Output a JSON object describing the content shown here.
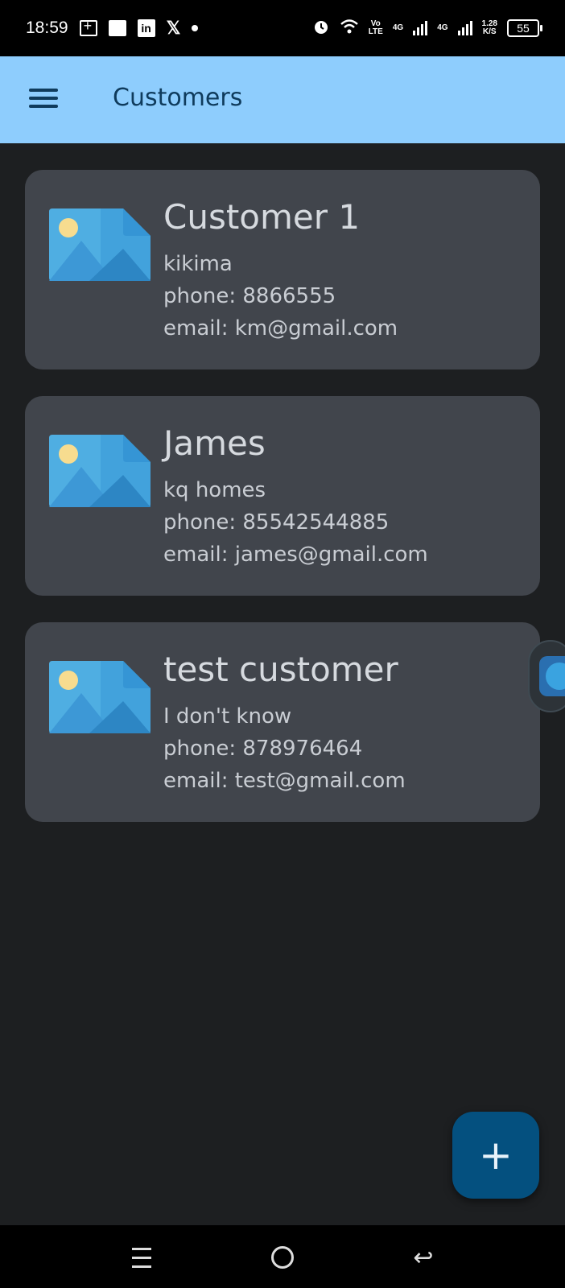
{
  "status_bar": {
    "time": "18:59",
    "network_label_top": "Vo",
    "network_label_bottom": "LTE",
    "signal1_label": "4G",
    "signal2_label": "4G",
    "speed_value": "1.28",
    "speed_unit": "K/S",
    "battery": "55"
  },
  "app_bar": {
    "title": "Customers"
  },
  "customers": [
    {
      "name": "Customer 1",
      "company": "kikima",
      "phone": "phone: 8866555",
      "email": "email: km@gmail.com"
    },
    {
      "name": "James",
      "company": "kq homes",
      "phone": "phone: 85542544885",
      "email": "email: james@gmail.com"
    },
    {
      "name": "test customer",
      "company": "I don't know",
      "phone": "phone: 878976464",
      "email": "email: test@gmail.com"
    }
  ],
  "fab": {
    "icon": "plus-icon",
    "label": "+"
  },
  "colors": {
    "app_bar_bg": "#8ecdfd",
    "background": "#1d1f21",
    "card_bg": "#41454c",
    "fab_bg": "#04507f"
  }
}
